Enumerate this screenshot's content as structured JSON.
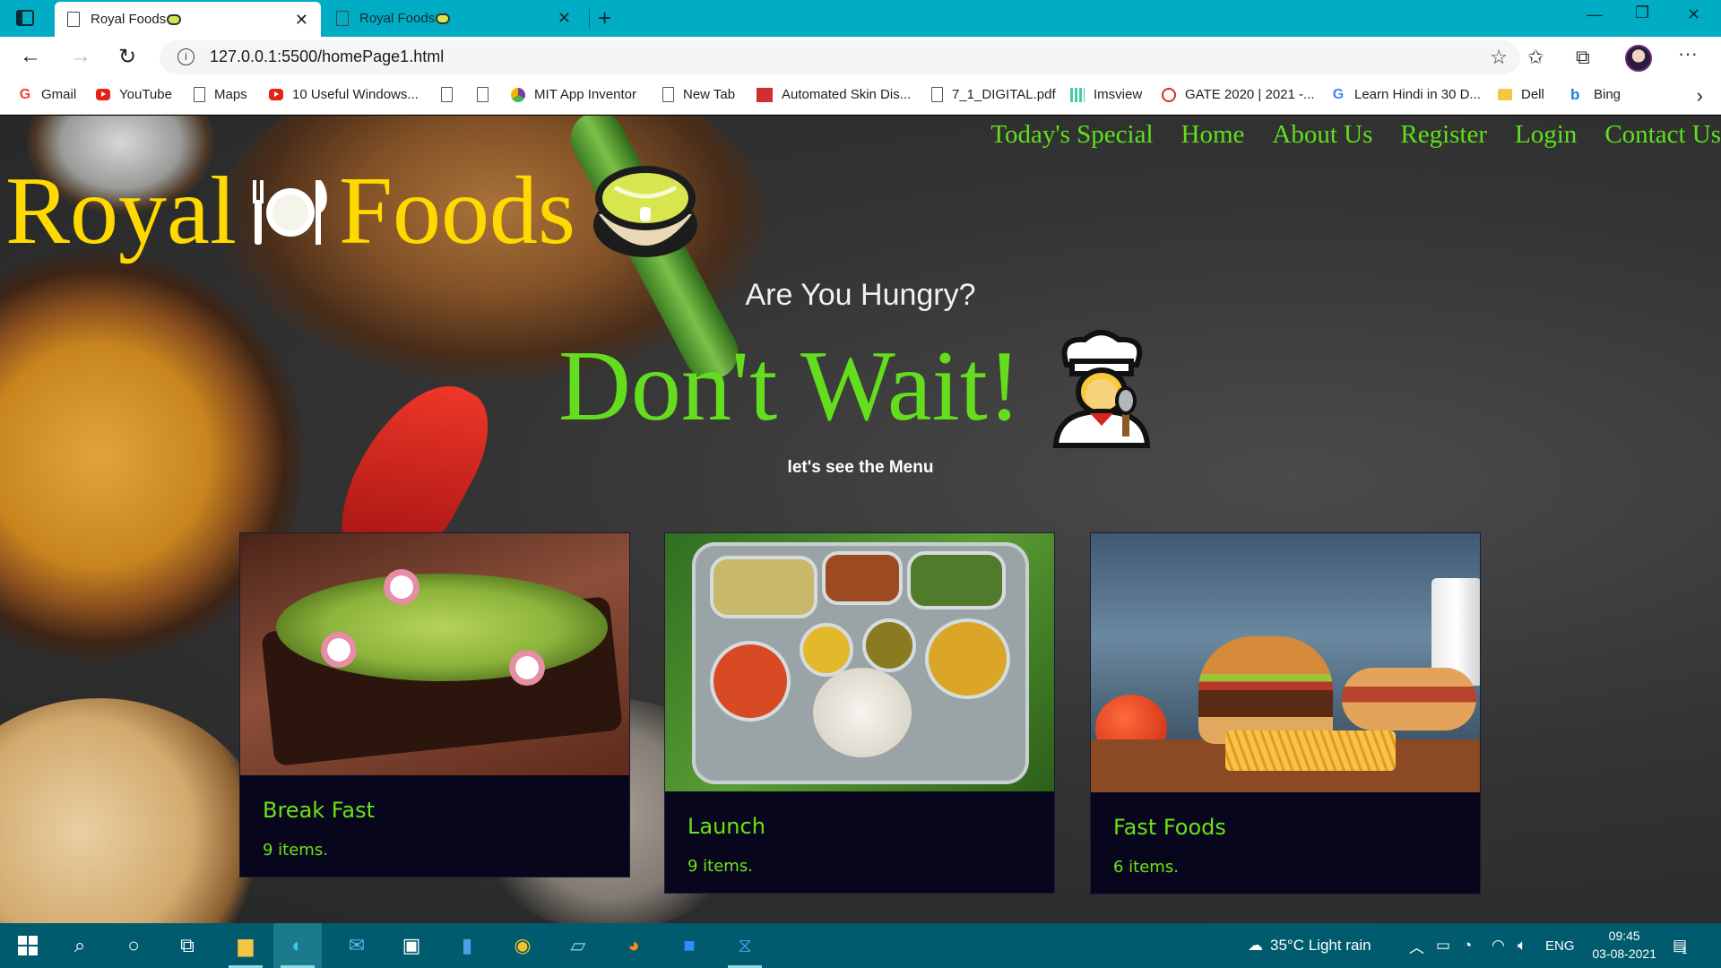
{
  "browser": {
    "tabs": [
      {
        "title": "Royal Foods",
        "active": true
      },
      {
        "title": "Royal Foods",
        "active": false
      }
    ],
    "url": "127.0.0.1:5500/homePage1.html",
    "bookmarks": [
      {
        "label": "Gmail",
        "icon": "gmail-icon"
      },
      {
        "label": "YouTube",
        "icon": "youtube-icon"
      },
      {
        "label": "Maps",
        "icon": "page-icon"
      },
      {
        "label": "10 Useful Windows...",
        "icon": "youtube-icon"
      },
      {
        "label": "",
        "icon": "page-icon"
      },
      {
        "label": "",
        "icon": "page-icon"
      },
      {
        "label": "MIT App Inventor",
        "icon": "mit-icon"
      },
      {
        "label": "New Tab",
        "icon": "page-icon"
      },
      {
        "label": "Automated Skin Dis...",
        "icon": "bh-icon"
      },
      {
        "label": "7_1_DIGITAL.pdf",
        "icon": "page-icon"
      },
      {
        "label": "Imsview",
        "icon": "imsview-icon"
      },
      {
        "label": "GATE 2020 | 2021 -...",
        "icon": "gate-icon"
      },
      {
        "label": "Learn Hindi in 30 D...",
        "icon": "google-icon"
      },
      {
        "label": "Dell",
        "icon": "folder-icon"
      },
      {
        "label": "Bing",
        "icon": "bing-icon"
      }
    ]
  },
  "site": {
    "nav": [
      "Today's Special",
      "Home",
      "About Us",
      "Register",
      "Login",
      "Contact Us"
    ],
    "brand_left": "Royal",
    "brand_right": "Foods",
    "hungry": "Are You Hungry?",
    "dont_wait": "Don't Wait!",
    "menu_sub": "let's see the Menu",
    "cards": [
      {
        "title": "Break Fast",
        "count": "9 items."
      },
      {
        "title": "Launch",
        "count": "9 items."
      },
      {
        "title": "Fast Foods",
        "count": "6 items."
      }
    ],
    "colors": {
      "brand": "#ffd900",
      "accent_green": "#63dd1d",
      "card_bg": "#08061d"
    }
  },
  "taskbar": {
    "weather": "35°C  Light rain",
    "lang": "ENG",
    "time": "09:45",
    "date": "03-08-2021",
    "notifications": "1"
  }
}
